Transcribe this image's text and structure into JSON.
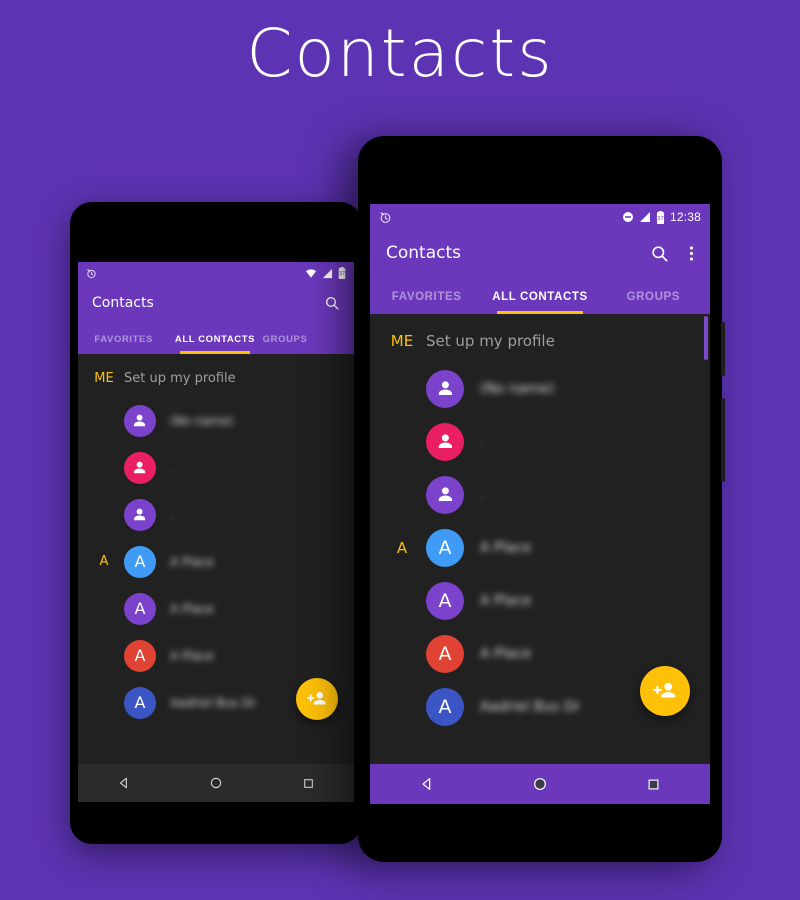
{
  "page": {
    "title": "Contacts",
    "background_color": "#5c33b2"
  },
  "theme": {
    "app_bar_purple": "#6b38bc",
    "accent_yellow": "#ffc107",
    "list_background": "#212121",
    "nav_bar_purple": "#6b38bc",
    "nav_bar_dark": "#2b2b2b"
  },
  "phone_front": {
    "status_bar": {
      "left_icon": "alarm-icon",
      "dnd_icon": "do-not-disturb-icon",
      "signal_icon": "signal-icon",
      "battery_icon": "battery-icon",
      "battery_level": "37",
      "time": "12:38"
    },
    "app_bar": {
      "title": "Contacts",
      "search_icon": "search-icon",
      "overflow_icon": "overflow-menu-icon"
    },
    "tabs": [
      {
        "label": "FAVORITES",
        "active": false
      },
      {
        "label": "ALL CONTACTS",
        "active": true
      },
      {
        "label": "GROUPS",
        "active": false
      }
    ],
    "list": {
      "me_section": {
        "letter": "ME",
        "text": "Set up my profile"
      },
      "contacts": [
        {
          "gutter": "",
          "initial": "",
          "icon": "person-icon",
          "color": "#7b42cc",
          "name": "(No name)",
          "tiny": false
        },
        {
          "gutter": "",
          "initial": "",
          "icon": "person-icon",
          "color": "#e91e63",
          "name": ".",
          "tiny": true
        },
        {
          "gutter": "",
          "initial": "",
          "icon": "person-icon",
          "color": "#7b42cc",
          "name": ".",
          "tiny": true
        },
        {
          "gutter": "A",
          "initial": "A",
          "icon": "",
          "color": "#3f9bf5",
          "name": "A Place",
          "tiny": false
        },
        {
          "gutter": "",
          "initial": "A",
          "icon": "",
          "color": "#7b42cc",
          "name": "A Place",
          "tiny": false
        },
        {
          "gutter": "",
          "initial": "A",
          "icon": "",
          "color": "#e04233",
          "name": "A Place",
          "tiny": false
        },
        {
          "gutter": "",
          "initial": "A",
          "icon": "",
          "color": "#3b55c4",
          "name": "Aadriel Bus Dr",
          "tiny": false
        }
      ]
    },
    "fab": {
      "icon": "add-person-icon",
      "color": "#ffc107"
    },
    "nav_bar": {
      "back_icon": "back-triangle-icon",
      "home_icon": "home-circle-icon",
      "recents_icon": "recents-square-icon"
    }
  },
  "phone_back": {
    "status_bar": {
      "left_icon": "alarm-icon",
      "wifi_icon": "wifi-icon",
      "signal_icon": "signal-icon",
      "battery_icon": "battery-icon",
      "battery_level": "37"
    },
    "app_bar": {
      "title": "Contacts",
      "search_icon": "search-icon"
    },
    "tabs": [
      {
        "label": "FAVORITES",
        "active": false
      },
      {
        "label": "ALL CONTACTS",
        "active": true
      },
      {
        "label": "GROUPS",
        "active": false
      }
    ],
    "list": {
      "me_section": {
        "letter": "ME",
        "text": "Set up my profile"
      },
      "contacts": [
        {
          "gutter": "",
          "initial": "",
          "icon": "person-icon",
          "color": "#7b42cc",
          "name": "(No name)",
          "tiny": false
        },
        {
          "gutter": "",
          "initial": "",
          "icon": "person-icon",
          "color": "#e91e63",
          "name": ".",
          "tiny": true
        },
        {
          "gutter": "",
          "initial": "",
          "icon": "person-icon",
          "color": "#7b42cc",
          "name": ".",
          "tiny": true
        },
        {
          "gutter": "A",
          "initial": "A",
          "icon": "",
          "color": "#3f9bf5",
          "name": "A Place",
          "tiny": false
        },
        {
          "gutter": "",
          "initial": "A",
          "icon": "",
          "color": "#7b42cc",
          "name": "A Place",
          "tiny": false
        },
        {
          "gutter": "",
          "initial": "A",
          "icon": "",
          "color": "#e04233",
          "name": "A Place",
          "tiny": false
        },
        {
          "gutter": "",
          "initial": "A",
          "icon": "",
          "color": "#3b55c4",
          "name": "Aadriel Bus Dr",
          "tiny": false
        }
      ]
    },
    "fab": {
      "icon": "add-person-icon",
      "color": "#ffc107"
    },
    "nav_bar": {
      "back_icon": "back-triangle-icon",
      "home_icon": "home-circle-icon",
      "recents_icon": "recents-square-icon"
    }
  }
}
